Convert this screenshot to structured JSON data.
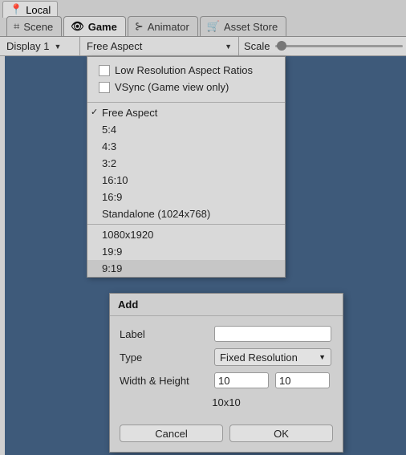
{
  "top_tab": {
    "label": "Local",
    "icon": "pin-icon"
  },
  "tabs": [
    {
      "label": "Scene",
      "icon": "scene-icon"
    },
    {
      "label": "Game",
      "icon": "game-icon",
      "active": true
    },
    {
      "label": "Animator",
      "icon": "animator-icon"
    },
    {
      "label": "Asset Store",
      "icon": "asset-store-icon"
    }
  ],
  "toolbar": {
    "display": "Display 1",
    "aspect": "Free Aspect",
    "scale_label": "Scale"
  },
  "dropdown": {
    "checks": [
      {
        "label": "Low Resolution Aspect Ratios",
        "checked": false
      },
      {
        "label": "VSync (Game view only)",
        "checked": false
      }
    ],
    "items_a": [
      {
        "label": "Free Aspect",
        "selected": true
      },
      {
        "label": "5:4"
      },
      {
        "label": "4:3"
      },
      {
        "label": "3:2"
      },
      {
        "label": "16:10"
      },
      {
        "label": "16:9"
      },
      {
        "label": "Standalone (1024x768)"
      }
    ],
    "items_b": [
      {
        "label": "1080x1920"
      },
      {
        "label": "19:9"
      },
      {
        "label": "9:19"
      }
    ]
  },
  "dialog": {
    "title": "Add",
    "label_field": {
      "label": "Label",
      "value": ""
    },
    "type_field": {
      "label": "Type",
      "value": "Fixed Resolution"
    },
    "size_field": {
      "label": "Width & Height",
      "width": "10",
      "height": "10"
    },
    "preview": "10x10",
    "cancel": "Cancel",
    "ok": "OK"
  }
}
